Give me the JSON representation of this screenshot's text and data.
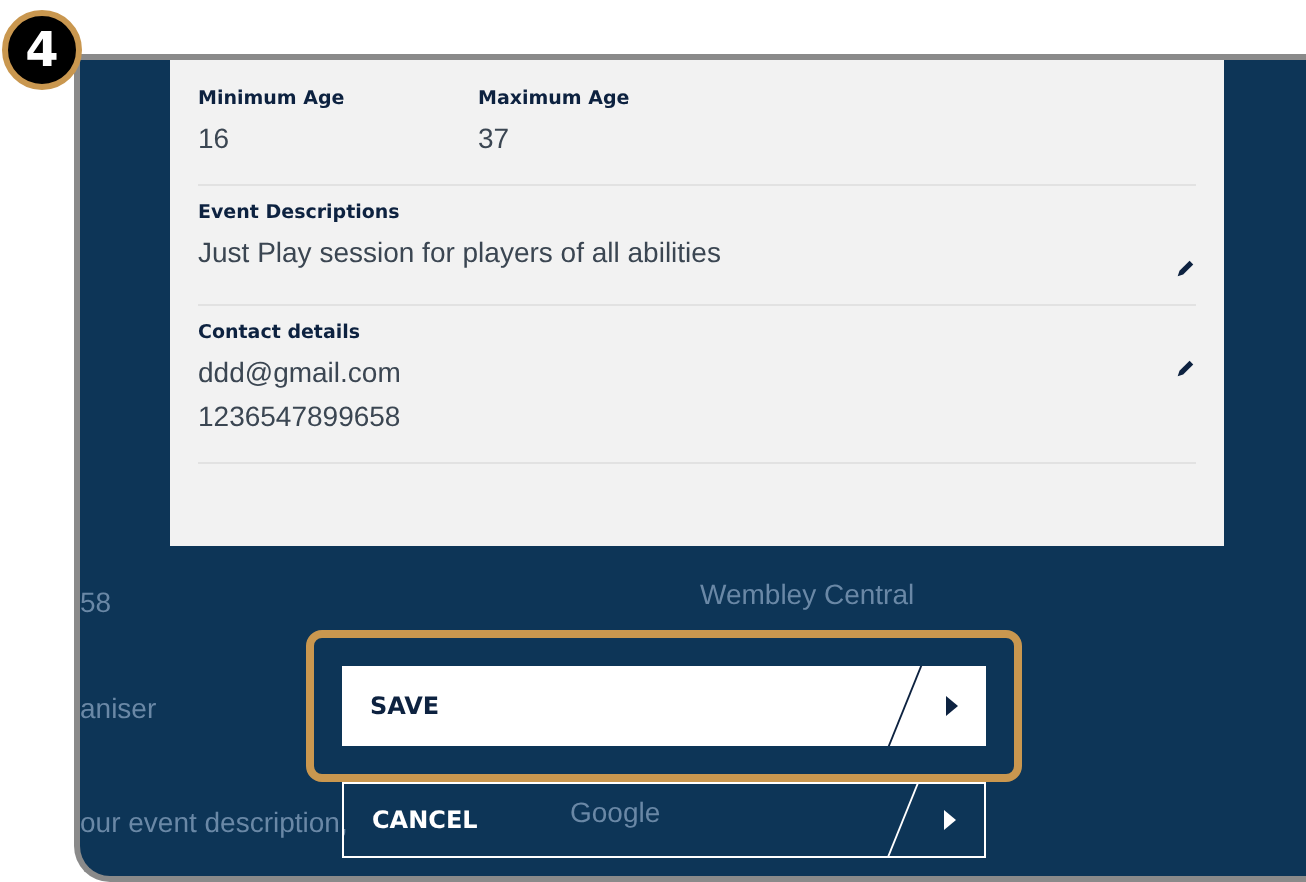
{
  "step_badge": "4",
  "background_texts": [
    "58",
    "aniser",
    "our event description,",
    "Wembley Central",
    "Google"
  ],
  "card": {
    "fields": [
      {
        "kind": "pair",
        "items": [
          {
            "label": "Minimum Age",
            "value": "16"
          },
          {
            "label": "Maximum Age",
            "value": "37"
          }
        ]
      },
      {
        "kind": "editable",
        "label": "Event Descriptions",
        "values": [
          "Just Play session for players of all abilities"
        ]
      },
      {
        "kind": "editable",
        "label": "Contact details",
        "values": [
          "ddd@gmail.com",
          "1236547899658"
        ]
      }
    ]
  },
  "buttons": [
    {
      "label": "SAVE",
      "kind": "primary",
      "highlighted": true
    },
    {
      "label": "CANCEL",
      "kind": "outline",
      "highlighted": false
    }
  ]
}
